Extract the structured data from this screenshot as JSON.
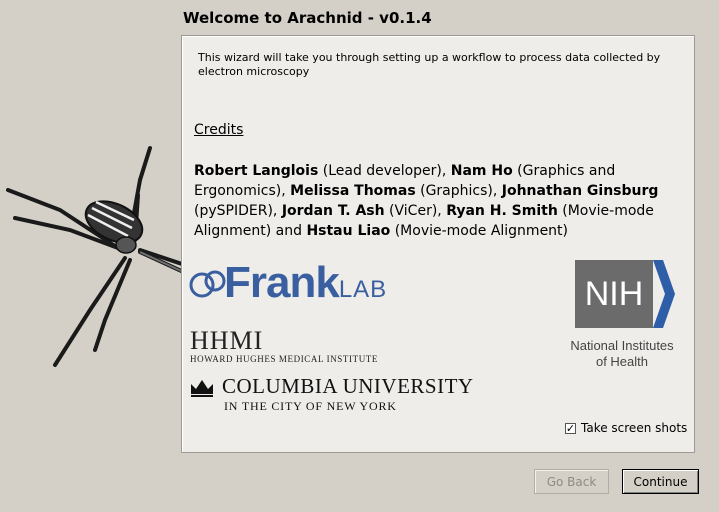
{
  "window": {
    "title": "Welcome to Arachnid - v0.1.4"
  },
  "panel": {
    "intro": "This wizard will take you through setting up a workflow to process data collected by electron microscopy",
    "credits_heading": "Credits",
    "credits": [
      {
        "name": "Robert Langlois",
        "role": " (Lead developer), "
      },
      {
        "name": "Nam Ho",
        "role": " (Graphics and Ergonomics), "
      },
      {
        "name": "Melissa Thomas",
        "role": " (Graphics), "
      },
      {
        "name": "Johnathan Ginsburg",
        "role": " (pySPIDER), "
      },
      {
        "name": "Jordan T. Ash",
        "role": " (ViCer), "
      },
      {
        "name": "Ryan H. Smith",
        "role": " (Movie-mode Alignment) and "
      },
      {
        "name": "Hstau Liao",
        "role": " (Movie-mode Alignment)"
      }
    ]
  },
  "logos": {
    "frank": {
      "big": "Frank",
      "small": "LAB"
    },
    "hhmi": {
      "big": "HHMI",
      "small": "HOWARD HUGHES MEDICAL INSTITUTE"
    },
    "columbia": {
      "main": "COLUMBIA UNIVERSITY",
      "sub": "IN THE CITY OF NEW YORK"
    },
    "nih": {
      "mark": "NIH",
      "caption_line1": "National Institutes",
      "caption_line2": "of Health"
    }
  },
  "options": {
    "screenshot_label": "Take screen shots",
    "screenshot_checked": true
  },
  "buttons": {
    "back_label": "Go Back",
    "back_enabled": false,
    "continue_label": "Continue"
  },
  "colors": {
    "background": "#d4d0c8",
    "panel": "#eeede9",
    "frank_blue": "#3a5fa0",
    "nih_grey": "#6b6b6b",
    "nih_blue": "#2f5ea8"
  }
}
